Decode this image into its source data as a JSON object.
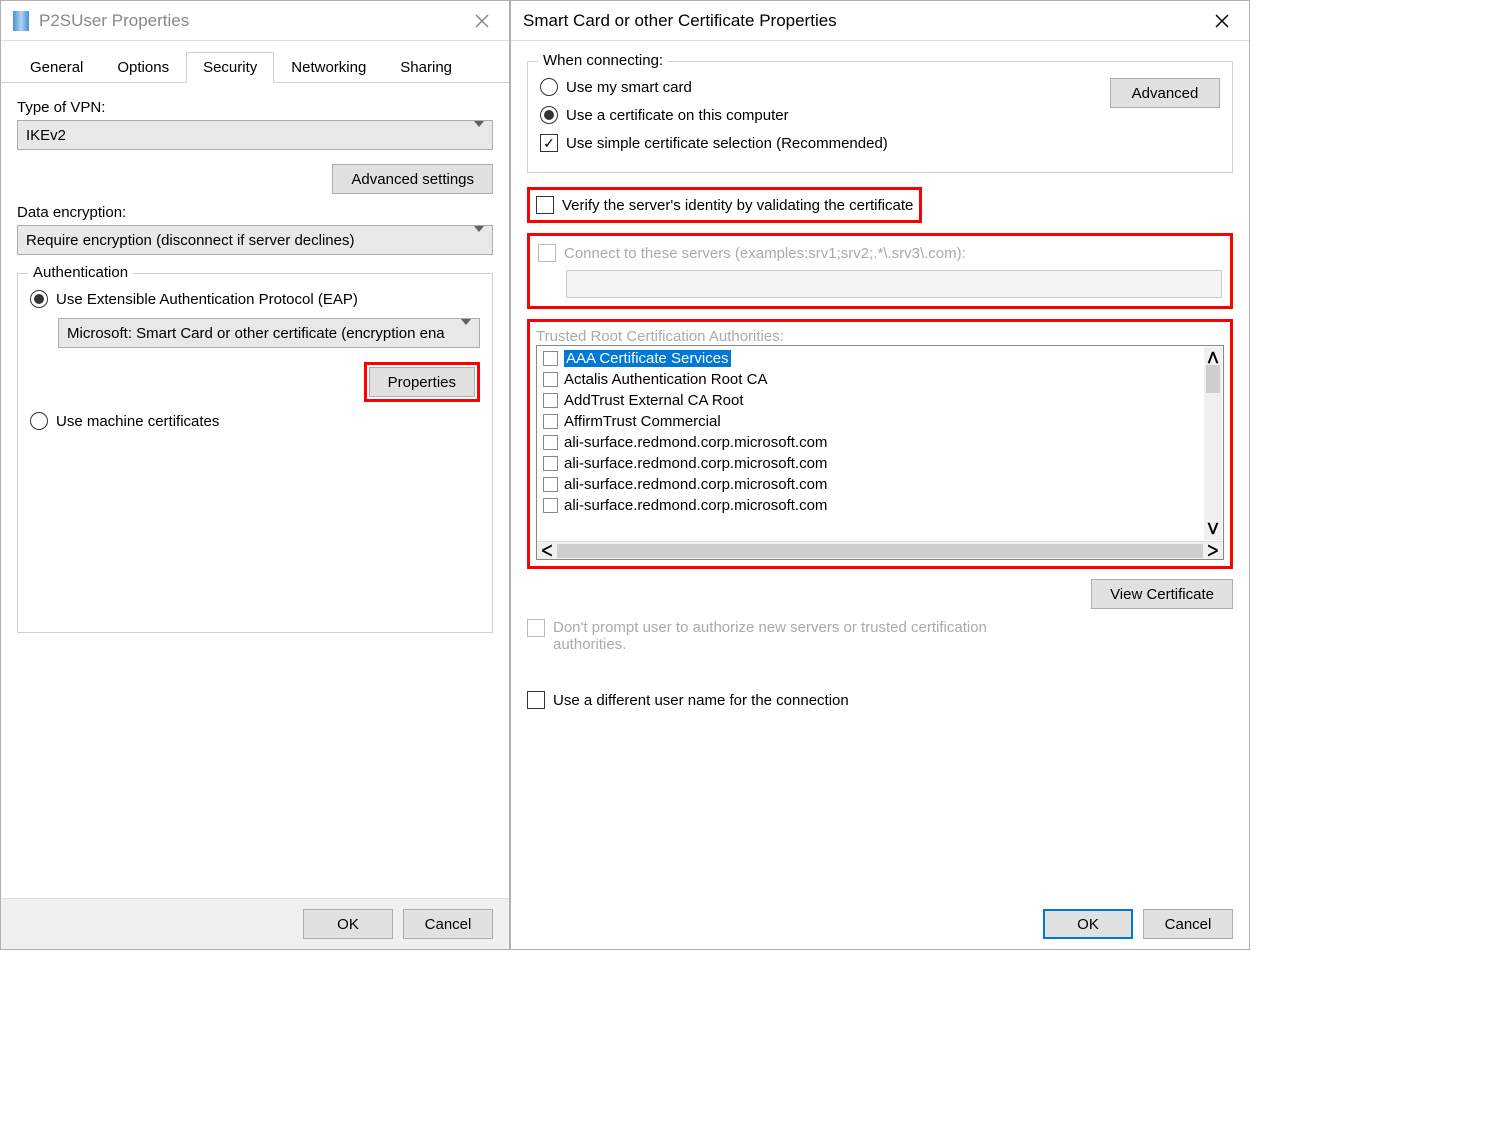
{
  "left": {
    "title": "P2SUser Properties",
    "tabs": [
      "General",
      "Options",
      "Security",
      "Networking",
      "Sharing"
    ],
    "activeTabIndex": 2,
    "vpn": {
      "label": "Type of VPN:",
      "value": "IKEv2"
    },
    "adv_settings_btn": "Advanced settings",
    "enc": {
      "label": "Data encryption:",
      "value": "Require encryption (disconnect if server declines)"
    },
    "auth": {
      "title": "Authentication",
      "eap_radio": "Use Extensible Authentication Protocol (EAP)",
      "eap_combo": "Microsoft: Smart Card or other certificate (encryption ena",
      "properties_btn": "Properties",
      "machine_radio": "Use machine certificates"
    },
    "ok": "OK",
    "cancel": "Cancel"
  },
  "right": {
    "title": "Smart Card or other Certificate Properties",
    "connect": {
      "title": "When connecting:",
      "smartcard": "Use my smart card",
      "localcert": "Use a certificate on this computer",
      "advanced_btn": "Advanced",
      "simple": "Use simple certificate selection (Recommended)"
    },
    "verify": "Verify the server's identity by validating the certificate",
    "connect_servers": "Connect to these servers (examples:srv1;srv2;.*\\.srv3\\.com):",
    "trusted": {
      "label": "Trusted Root Certification Authorities:",
      "items": [
        "AAA Certificate Services",
        "Actalis Authentication Root CA",
        "AddTrust External CA Root",
        "AffirmTrust Commercial",
        "ali-surface.redmond.corp.microsoft.com",
        "ali-surface.redmond.corp.microsoft.com",
        "ali-surface.redmond.corp.microsoft.com",
        "ali-surface.redmond.corp.microsoft.com"
      ]
    },
    "view_cert_btn": "View Certificate",
    "dont_prompt": "Don't prompt user to authorize new servers or trusted certification authorities.",
    "diff_user": "Use a different user name for the connection",
    "ok": "OK",
    "cancel": "Cancel"
  }
}
